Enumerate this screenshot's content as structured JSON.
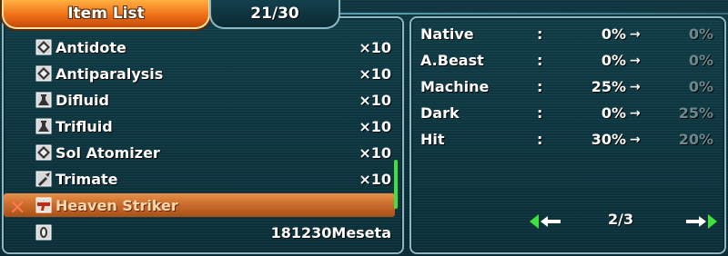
{
  "tabs": {
    "title": "Item List",
    "count": "21/30"
  },
  "items": [
    {
      "icon": "diamond-item-icon",
      "name": "Antidote",
      "qty": "×10"
    },
    {
      "icon": "diamond-item-icon",
      "name": "Antiparalysis",
      "qty": "×10"
    },
    {
      "icon": "flask-icon",
      "name": "Difluid",
      "qty": "×10"
    },
    {
      "icon": "flask-icon",
      "name": "Trifluid",
      "qty": "×10"
    },
    {
      "icon": "diamond-item-icon",
      "name": "Sol Atomizer",
      "qty": "×10"
    },
    {
      "icon": "syringe-icon",
      "name": "Trimate",
      "qty": "×10"
    },
    {
      "icon": "gun-icon",
      "name": "Heaven Striker",
      "qty": "",
      "selected": true
    },
    {
      "icon": "meseta-icon",
      "name": "",
      "qty": "181230Meseta"
    }
  ],
  "stats": [
    {
      "label": "Native",
      "colon": ":",
      "current": "0%",
      "new": "0%"
    },
    {
      "label": "A.Beast",
      "colon": ":",
      "current": "0%",
      "new": "0%"
    },
    {
      "label": "Machine",
      "colon": ":",
      "current": "25%",
      "new": "0%"
    },
    {
      "label": "Dark",
      "colon": ":",
      "current": "0%",
      "new": "25%"
    },
    {
      "label": "Hit",
      "colon": ":",
      "current": "30%",
      "new": "20%"
    }
  ],
  "pager": {
    "text": "2/3"
  },
  "colors": {
    "accent_orange": "#f07018",
    "panel_border": "#8ab8c4",
    "arrow_green": "#40e040"
  }
}
